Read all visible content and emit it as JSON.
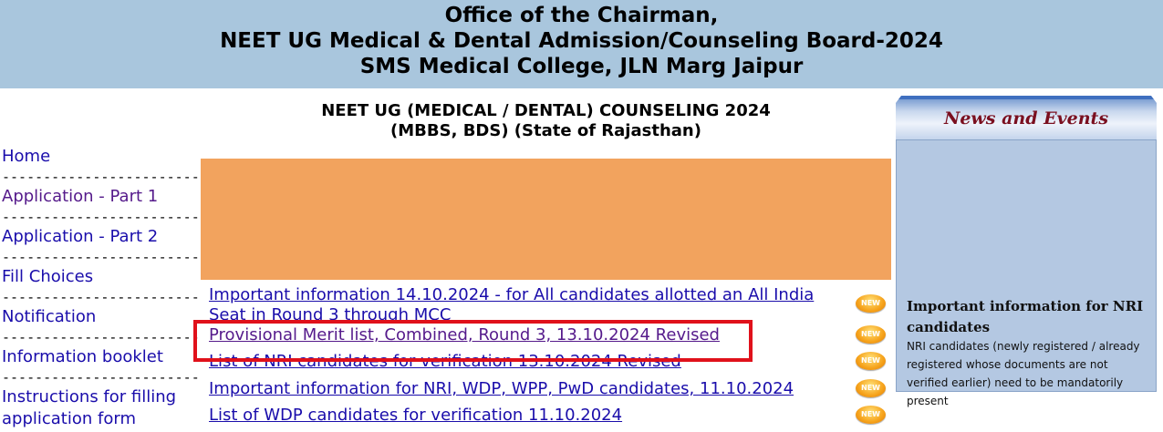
{
  "header": {
    "line1": "Office of the Chairman,",
    "line2": "NEET UG Medical & Dental Admission/Counseling Board-2024",
    "line3": "SMS Medical College, JLN Marg Jaipur"
  },
  "sidebar": {
    "separator": "------------------------",
    "items": [
      {
        "label": "Home"
      },
      {
        "label": "Application - Part 1"
      },
      {
        "label": "Application - Part 2"
      },
      {
        "label": "Fill Choices"
      },
      {
        "label": "Notification"
      },
      {
        "label": "Information booklet"
      },
      {
        "label": "Instructions for filling application form"
      }
    ]
  },
  "main": {
    "title_line1": "NEET UG (MEDICAL / DENTAL) COUNSELING 2024",
    "title_line2": "(MBBS, BDS) (State of Rajasthan)",
    "banner_color": "#f2a35e",
    "new_badge": "NEW",
    "notices": [
      {
        "text": "Important information 14.10.2024 - for All candidates allotted an All India Seat in Round 3 through MCC"
      },
      {
        "text": "Provisional Merit list, Combined, Round 3, 13.10.2024 Revised"
      },
      {
        "text": "List of NRI candidates for verification 13.10.2024 Revised"
      },
      {
        "text": "Important information for NRI, WDP, WPP, PwD candidates, 11.10.2024"
      },
      {
        "text": "List of WDP candidates for verification 11.10.2024"
      }
    ]
  },
  "news": {
    "heading": "News and Events",
    "item_title": "Important information for NRI candidates",
    "item_text": "NRI candidates (newly registered / already registered whose documents are not verified earlier) need to be mandatorily present"
  },
  "colors": {
    "header_bg": "#a9c6dd",
    "link": "#1a0dab",
    "visited": "#551a8b",
    "highlight_border": "#e0111b"
  }
}
